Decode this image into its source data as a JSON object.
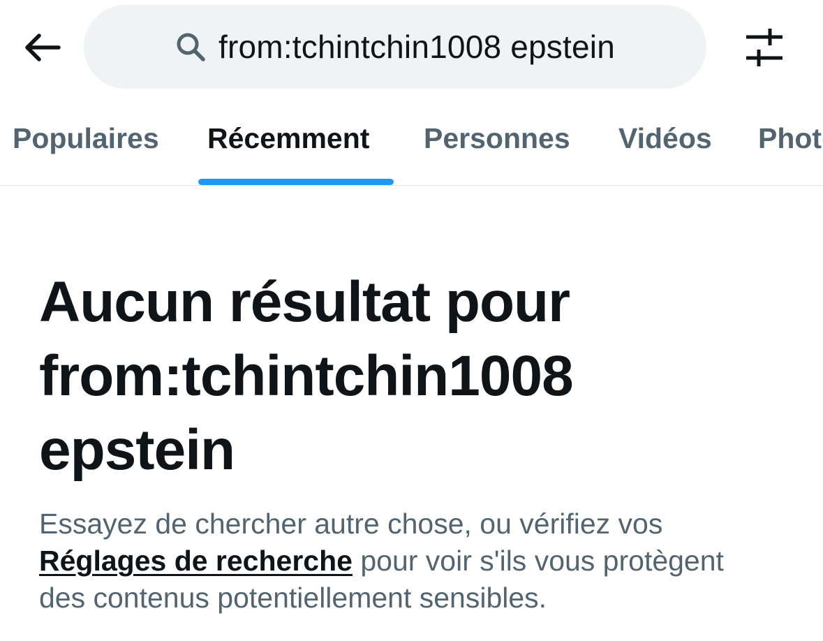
{
  "search": {
    "query": "from:tchintchin1008 epstein"
  },
  "tabs": [
    {
      "label": "Populaires",
      "active": false
    },
    {
      "label": "Récemment",
      "active": true
    },
    {
      "label": "Personnes",
      "active": false
    },
    {
      "label": "Vidéos",
      "active": false
    },
    {
      "label": "Photos",
      "active": false
    }
  ],
  "empty_state": {
    "title_line1": "Aucun résultat pour",
    "title_line2": "from:tchintchin1008",
    "title_line3": "epstein",
    "desc_line1": "Essayez de chercher autre chose, ou vérifiez vos",
    "settings_link": "Réglages de recherche",
    "desc_line2_rest": " pour voir s'ils vous protègent",
    "desc_line3": "des contenus potentiellement sensibles."
  },
  "colors": {
    "accent": "#1d9bf0",
    "text_primary": "#0f1419",
    "text_secondary": "#536471",
    "search_bg": "#eff3f4"
  },
  "icons": {
    "back": "arrow-left-icon",
    "search": "search-icon",
    "filter": "sliders-icon"
  }
}
